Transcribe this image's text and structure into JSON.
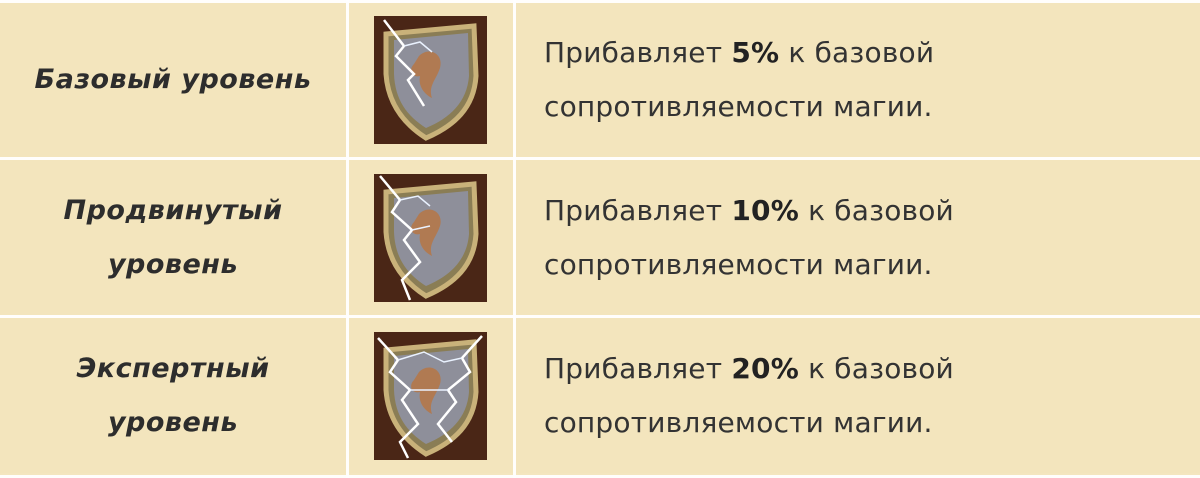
{
  "rows": [
    {
      "name": "Базовый уровень",
      "icon": "magic-resistance-shield-icon",
      "desc_before": "Прибавляет ",
      "desc_value": "5%",
      "desc_after": " к базовой",
      "desc_line2": "сопротивляемости магии."
    },
    {
      "name": "Продвинутый уровень",
      "icon": "magic-resistance-shield-icon",
      "desc_before": "Прибавляет ",
      "desc_value": "10%",
      "desc_after": " к базовой",
      "desc_line2": "сопротивляемости магии."
    },
    {
      "name": "Экспертный уровень",
      "icon": "magic-resistance-shield-icon",
      "desc_before": "Прибавляет ",
      "desc_value": "20%",
      "desc_after": " к базовой",
      "desc_line2": "сопротивляемости магии."
    }
  ],
  "colors": {
    "background": "#f3e5bd",
    "grid": "#ffffff",
    "text": "#333333"
  }
}
